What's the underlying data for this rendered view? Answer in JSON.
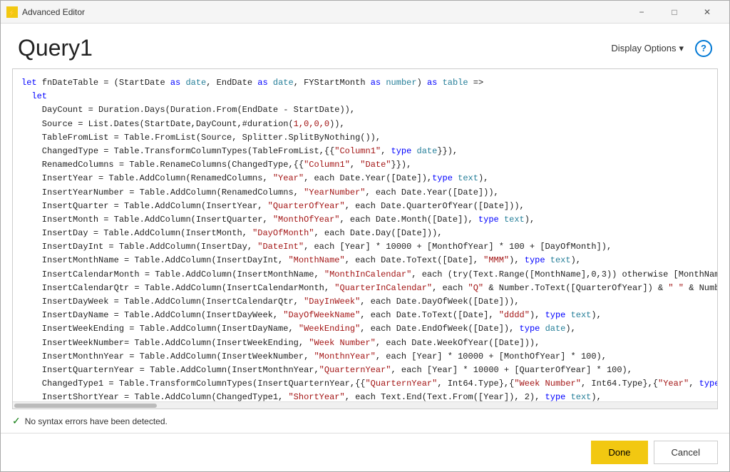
{
  "window": {
    "title": "Advanced Editor",
    "icon_label": "PBI"
  },
  "title_bar": {
    "title": "Advanced Editor",
    "minimize_label": "−",
    "maximize_label": "□",
    "close_label": "✕"
  },
  "header": {
    "query_title": "Query1",
    "display_options_label": "Display Options",
    "display_options_arrow": "▾",
    "help_label": "?"
  },
  "status": {
    "check_icon": "✓",
    "message": "No syntax errors have been detected."
  },
  "footer": {
    "done_label": "Done",
    "cancel_label": "Cancel"
  }
}
